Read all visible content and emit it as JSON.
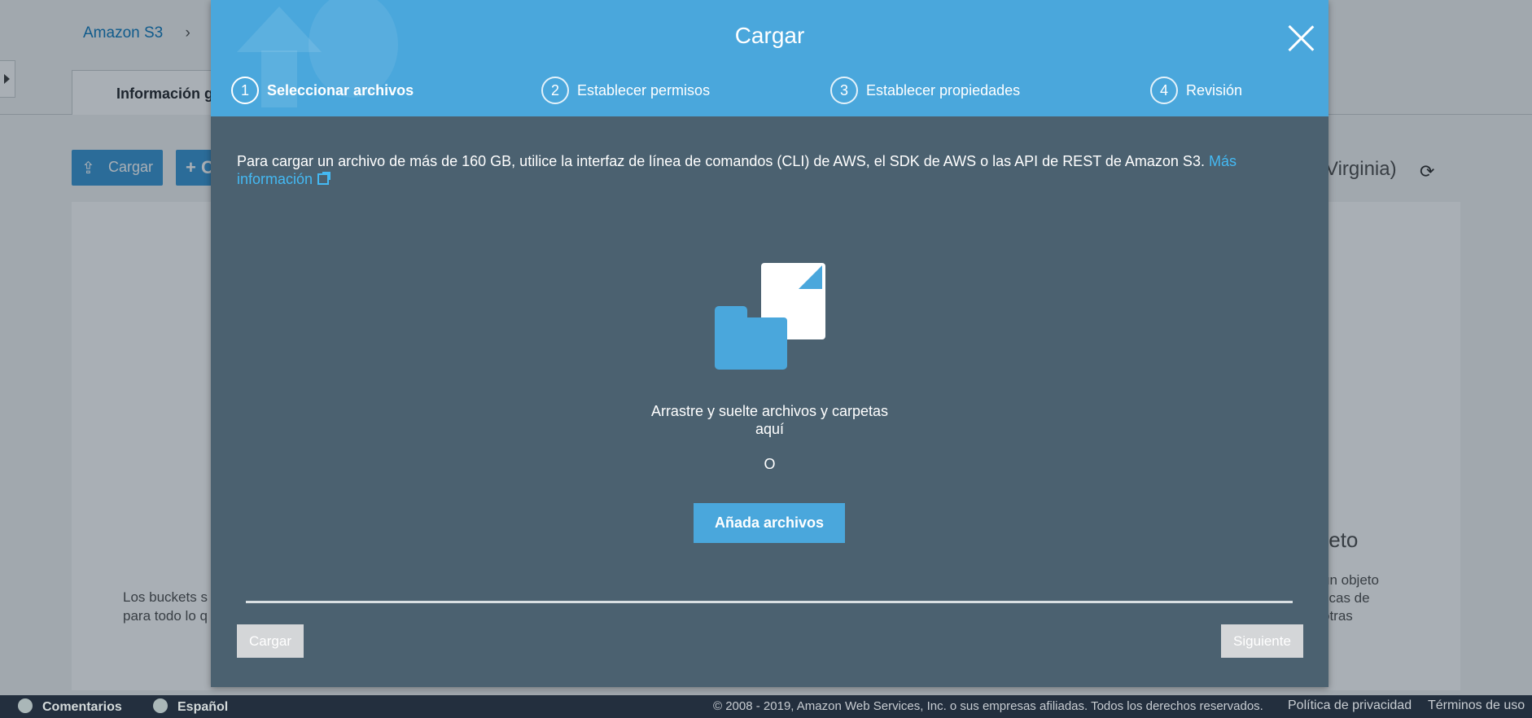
{
  "background": {
    "breadcrumb": [
      "Amazon S3",
      "›"
    ],
    "tab_label": "Información g",
    "upload_button": "Cargar",
    "create_button_partial": "+ C",
    "region_partial": "Virginia)",
    "left_text": [
      "Los buckets s",
      "para todo lo q"
    ],
    "right_heading": "bjeto",
    "right_text": [
      "un objeto",
      "ticas de",
      "otras"
    ]
  },
  "modal": {
    "title": "Cargar",
    "steps": [
      {
        "num": "1",
        "label": "Seleccionar archivos",
        "active": true
      },
      {
        "num": "2",
        "label": "Establecer permisos",
        "active": false
      },
      {
        "num": "3",
        "label": "Establecer propiedades",
        "active": false
      },
      {
        "num": "4",
        "label": "Revisión",
        "active": false
      }
    ],
    "info_text": "Para cargar un archivo de más de 160 GB, utilice la interfaz de línea de comandos (CLI) de AWS, el SDK de AWS o las API de REST de Amazon S3. ",
    "info_link": "Más información",
    "drop_text": "Arrastre y suelte archivos y carpetas aquí",
    "or_text": "O",
    "add_files_button": "Añada archivos",
    "upload_button": "Cargar",
    "next_button": "Siguiente"
  },
  "footer": {
    "feedback": "Comentarios",
    "language": "Español",
    "copyright": "© 2008 - 2019, Amazon Web Services, Inc. o sus empresas afiliadas. Todos los derechos reservados.",
    "privacy": "Política de privacidad",
    "terms": "Términos de uso"
  },
  "colors": {
    "modal_header": "#4aa7dc",
    "modal_body": "#4b6170",
    "link": "#44b9f3",
    "footer": "#232f3e"
  },
  "icons": [
    "close-icon",
    "upload-icon",
    "folder-icon",
    "document-icon",
    "external-link-icon",
    "refresh-icon",
    "comment-icon",
    "globe-icon"
  ]
}
